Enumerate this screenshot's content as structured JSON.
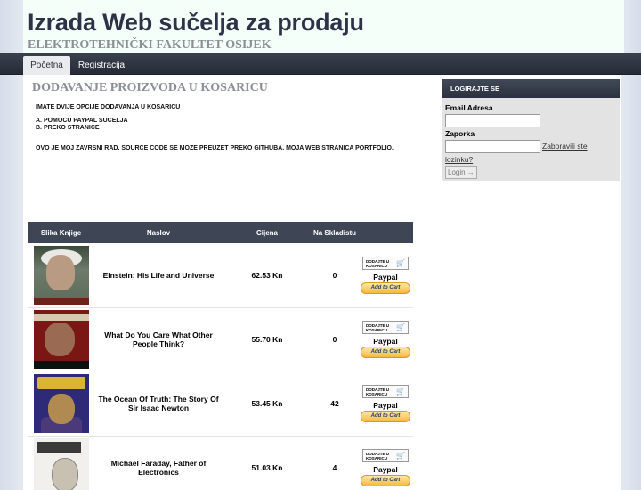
{
  "header": {
    "title": "Izrada Web sučelja za prodaju",
    "subtitle": "ELEKTROTEHNIČKI FAKULTET OSIJEK"
  },
  "nav": {
    "tabs": [
      {
        "label": "Početna",
        "active": true
      },
      {
        "label": "Registracija",
        "active": false
      }
    ]
  },
  "main": {
    "heading": "DODAVANJE PROIZVODA U KOSARICU",
    "intro_line": "IMATE DVIJE OPCIJE DODAVANJA U KOSARICU",
    "option_a": "A. POMOCU PAYPAL SUCELJA",
    "option_b": "B. PREKO STRANICE",
    "note_prefix": "OVO JE MOJ ZAVRSNI RAD. SOURCE CODE SE MOZE PREUZET PREKO",
    "github_link": "GITHUBA",
    "note_middle": ". MOJA WEB STRANICA",
    "portfolio_link": "PORTFOLIO",
    "note_suffix": "."
  },
  "table": {
    "headers": {
      "image": "Slika Knjige",
      "title": "Naslov",
      "price": "Cijena",
      "stock": "Na Skladistu"
    },
    "add_button_label": "DODAJTE U KOSARICU",
    "paypal_label": "Paypal",
    "paypal_button_label": "Add to Cart",
    "rows": [
      {
        "title": "Einstein: His Life and Universe",
        "price": "62.53 Kn",
        "stock": "0"
      },
      {
        "title": "What Do You Care What Other People Think?",
        "price": "55.70 Kn",
        "stock": "0"
      },
      {
        "title": "The Ocean Of Truth: The Story Of Sir Isaac Newton",
        "price": "53.45 Kn",
        "stock": "42"
      },
      {
        "title": "Michael Faraday, Father of Electronics",
        "price": "51.03 Kn",
        "stock": "4"
      }
    ]
  },
  "login": {
    "title": "LOGIRAJTE SE",
    "email_label": "Email Adresa",
    "password_label": "Zaporka",
    "forgot_part1": "Zaboravili ste",
    "forgot_part2": "lozinku?",
    "button_label": "Login →"
  },
  "icons": {
    "cart": "cart-icon"
  },
  "colors": {
    "navbar": "#2e3440",
    "table_header": "#3e4656",
    "heading_grey": "#8b8f95",
    "paypal_button": "#f6b83b"
  }
}
